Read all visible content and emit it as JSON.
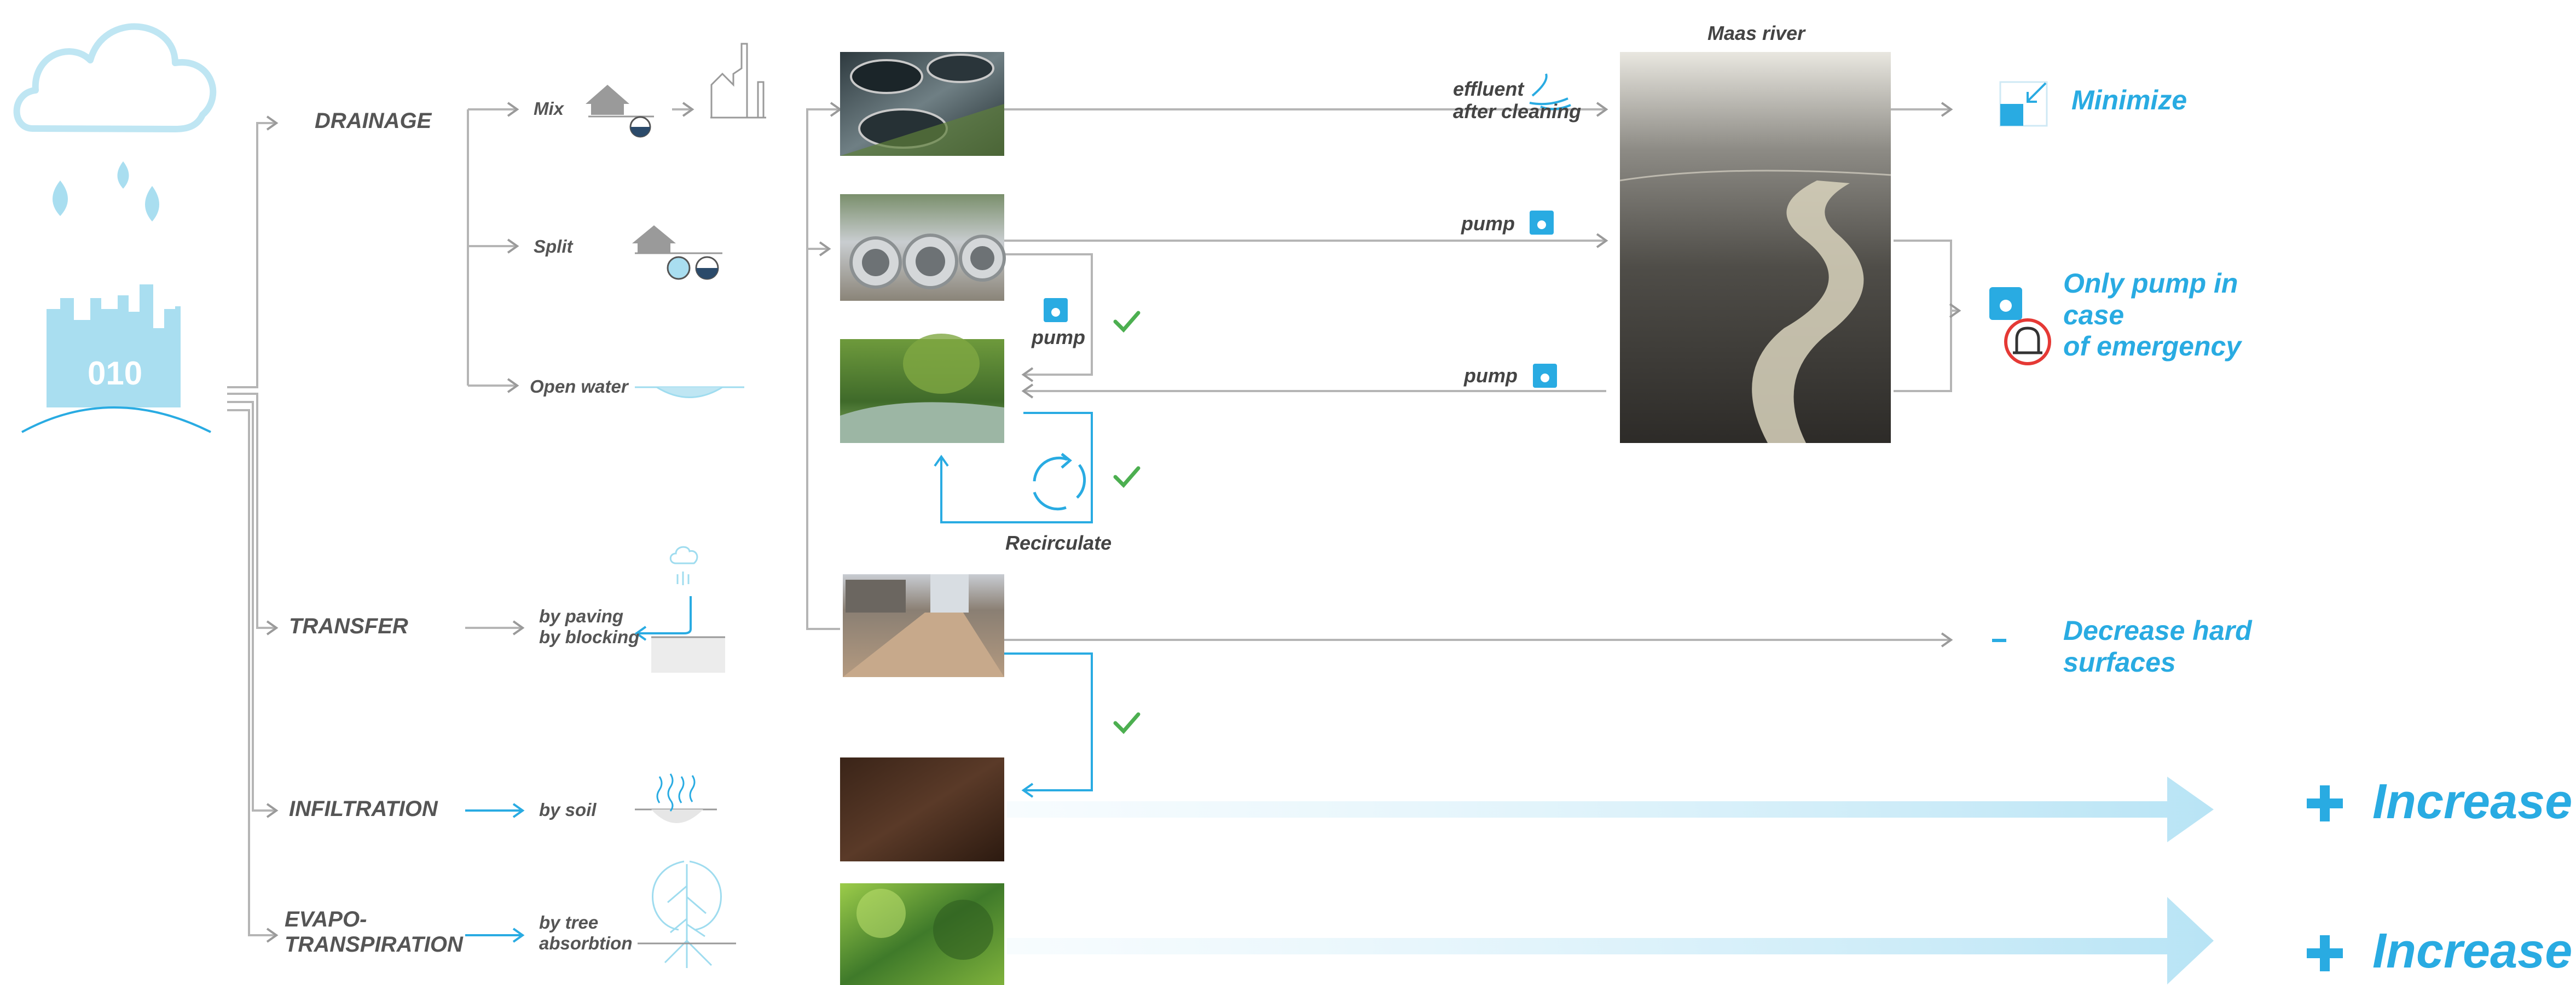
{
  "city": {
    "badge": "010"
  },
  "categories": {
    "drainage": "DRAINAGE",
    "transfer": "TRANSFER",
    "infiltration": "INFILTRATION",
    "evapotranspiration": [
      "EVAPO-",
      "TRANSPIRATION"
    ]
  },
  "drainage_methods": {
    "mix": "Mix",
    "split": "Split",
    "open_water": "Open water"
  },
  "transfer_methods": [
    "by paving",
    "by blocking"
  ],
  "infiltration_method": "by soil",
  "evapotranspiration_method": [
    "by tree",
    "absorbtion"
  ],
  "flows": {
    "effluent": [
      "effluent",
      "after cleaning"
    ],
    "pump_top": "pump",
    "pump_mid": "pump",
    "pump_loop": "pump",
    "recirculate": "Recirculate"
  },
  "river": {
    "title": "Maas river"
  },
  "results": {
    "minimize": "Minimize",
    "emergency": [
      "Only pump in",
      "case",
      "of emergency"
    ],
    "decrease": [
      "Decrease hard",
      "surfaces"
    ],
    "increase_infiltration": "Increase",
    "increase_evapo": "Increase"
  },
  "symbols": {
    "plus": "+",
    "minus": "-",
    "check": "✓"
  },
  "icons": [
    "cloud-icon",
    "raindrop-icon",
    "city-skyline-icon",
    "house-icon",
    "factory-icon",
    "half-circle-icon",
    "split-circles-icon",
    "basin-icon",
    "paving-icon",
    "soil-icon",
    "tree-icon",
    "pump-icon",
    "water-effluent-icon",
    "recirculate-icon",
    "check-icon",
    "minimize-icon",
    "alarm-icon"
  ],
  "colors": {
    "accent": "#29abe2",
    "light_accent": "#9fdcef",
    "line": "#aaaaaa",
    "check": "#4caf50",
    "alarm_red": "#e53935"
  }
}
